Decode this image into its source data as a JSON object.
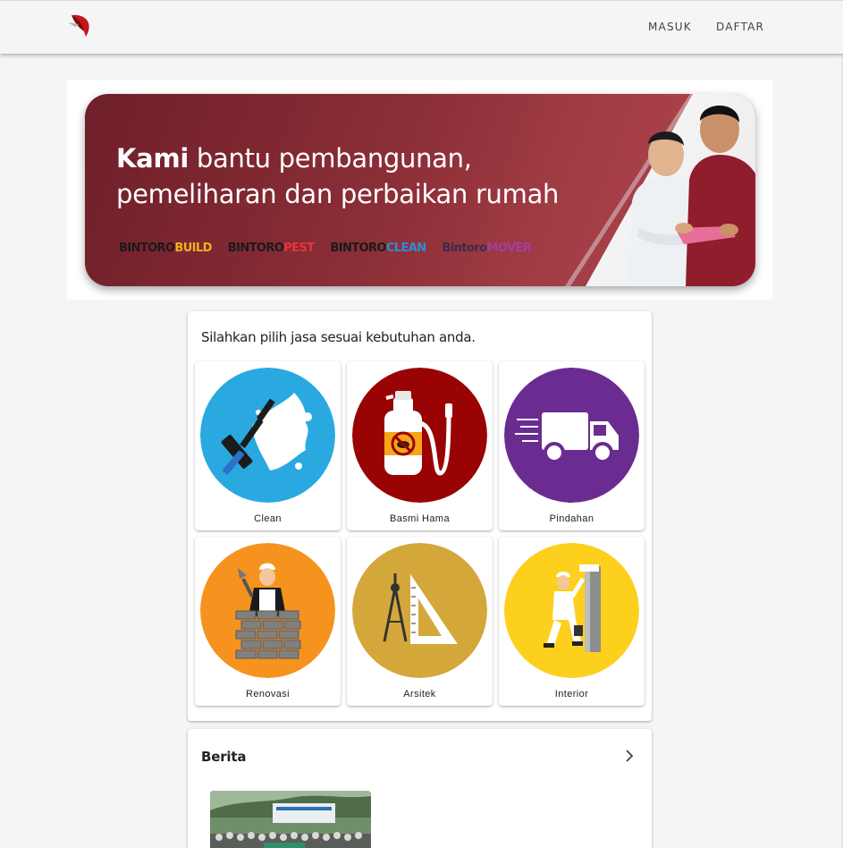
{
  "header": {
    "logo_icon": "bintoro-logo-icon",
    "nav": [
      {
        "label": "MASUK"
      },
      {
        "label": "DAFTAR"
      }
    ]
  },
  "banner": {
    "title_bold": "Kami",
    "title_rest_line1": " bantu pembangunan,",
    "title_line2": "pemeliharan dan perbaikan rumah",
    "brands": [
      {
        "prefix": "BINTORO",
        "suffix": "BUILD"
      },
      {
        "prefix": "BINTORO",
        "suffix": "PEST"
      },
      {
        "prefix": "BINTORO",
        "suffix": "CLEAN"
      },
      {
        "prefix": "Bintoro",
        "suffix": "MOVER"
      }
    ]
  },
  "services": {
    "heading": "Silahkan pilih jasa sesuai kebutuhan anda.",
    "items": [
      {
        "label": "Clean",
        "icon": "squeegee-icon",
        "color": "#29a9df"
      },
      {
        "label": "Basmi Hama",
        "icon": "spray-bottle-icon",
        "color": "#9a0303"
      },
      {
        "label": "Pindahan",
        "icon": "moving-truck-icon",
        "color": "#6a2c91"
      },
      {
        "label": "Renovasi",
        "icon": "bricklayer-icon",
        "color": "#f6931e"
      },
      {
        "label": "Arsitek",
        "icon": "compass-ruler-icon",
        "color": "#d4a73b"
      },
      {
        "label": "Interior",
        "icon": "painter-icon",
        "color": "#fcd01c"
      }
    ]
  },
  "news": {
    "title": "Berita",
    "more_icon": "chevron-right-icon"
  },
  "colors": {
    "brand_red": "#c4161c",
    "banner_dark": "#6e1f2a",
    "background": "#f5f5f5"
  }
}
